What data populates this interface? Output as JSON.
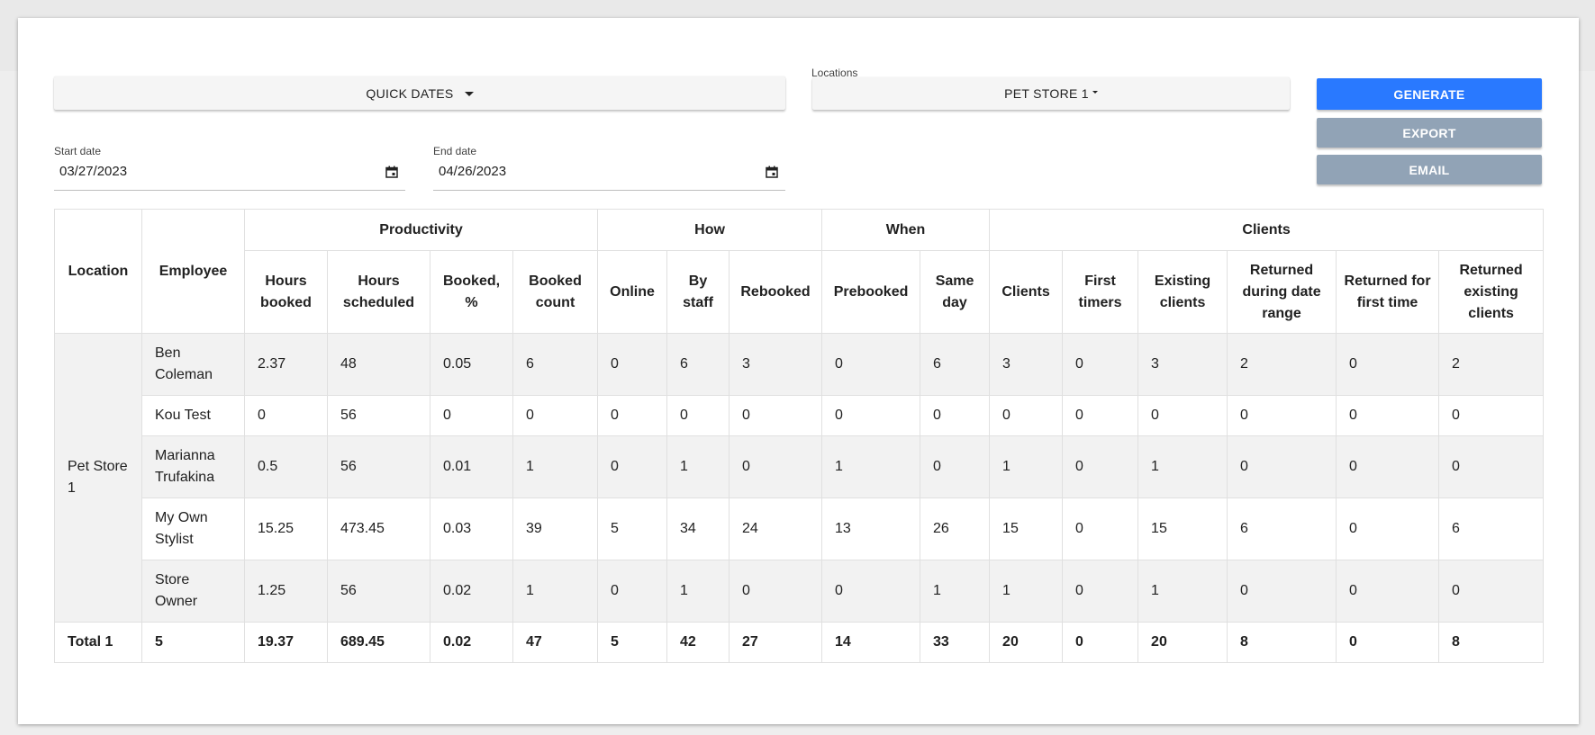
{
  "controls": {
    "quick_dates_label": "QUICK DATES",
    "locations_label": "Locations",
    "location_value": "PET STORE 1",
    "generate_label": "GENERATE",
    "export_label": "EXPORT",
    "email_label": "EMAIL",
    "start_date_label": "Start date",
    "start_date_value": "03/27/2023",
    "end_date_label": "End date",
    "end_date_value": "04/26/2023"
  },
  "colors": {
    "primary": "#2979ff",
    "disabled": "#91a3b6",
    "row_shade": "#f2f2f2"
  },
  "icons": {
    "dropdown": "caret-down-icon",
    "calendar": "calendar-icon"
  },
  "table": {
    "group_headers": {
      "location": "Location",
      "employee": "Employee",
      "productivity": "Productivity",
      "how": "How",
      "when": "When",
      "clients": "Clients"
    },
    "columns": [
      "Hours booked",
      "Hours scheduled",
      "Booked, %",
      "Booked count",
      "Online",
      "By staff",
      "Rebooked",
      "Prebooked",
      "Same day",
      "Clients",
      "First timers",
      "Existing clients",
      "Returned during date range",
      "Returned for first time",
      "Returned existing clients"
    ],
    "location_name": "Pet Store 1",
    "rows": [
      {
        "employee": "Ben Coleman",
        "values": [
          "2.37",
          "48",
          "0.05",
          "6",
          "0",
          "6",
          "3",
          "0",
          "6",
          "3",
          "0",
          "3",
          "2",
          "0",
          "2"
        ]
      },
      {
        "employee": "Kou Test",
        "values": [
          "0",
          "56",
          "0",
          "0",
          "0",
          "0",
          "0",
          "0",
          "0",
          "0",
          "0",
          "0",
          "0",
          "0",
          "0"
        ]
      },
      {
        "employee": "Marianna Trufakina",
        "values": [
          "0.5",
          "56",
          "0.01",
          "1",
          "0",
          "1",
          "0",
          "1",
          "0",
          "1",
          "0",
          "1",
          "0",
          "0",
          "0"
        ]
      },
      {
        "employee": "My Own Stylist",
        "values": [
          "15.25",
          "473.45",
          "0.03",
          "39",
          "5",
          "34",
          "24",
          "13",
          "26",
          "15",
          "0",
          "15",
          "6",
          "0",
          "6"
        ]
      },
      {
        "employee": "Store Owner",
        "values": [
          "1.25",
          "56",
          "0.02",
          "1",
          "0",
          "1",
          "0",
          "0",
          "1",
          "1",
          "0",
          "1",
          "0",
          "0",
          "0"
        ]
      }
    ],
    "total": {
      "label": "Total 1",
      "employee_count": "5",
      "values": [
        "19.37",
        "689.45",
        "0.02",
        "47",
        "5",
        "42",
        "27",
        "14",
        "33",
        "20",
        "0",
        "20",
        "8",
        "0",
        "8"
      ]
    }
  }
}
